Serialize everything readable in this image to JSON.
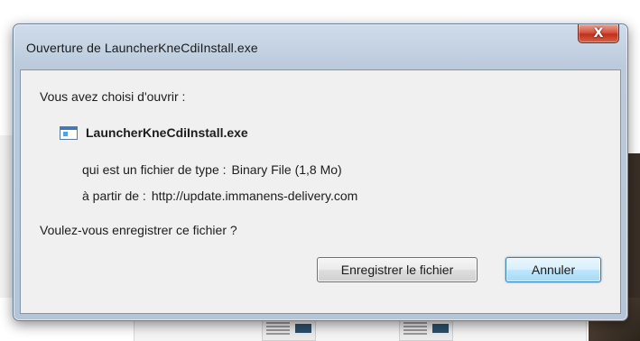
{
  "dialog": {
    "title": "Ouverture de LauncherKneCdiInstall.exe",
    "close_glyph": "X",
    "intro": "Vous avez choisi d'ouvrir :",
    "file": {
      "icon": "exe-file-icon",
      "name": "LauncherKneCdiInstall.exe"
    },
    "type_label": "qui est un fichier de type :",
    "type_value": "Binary File (1,8 Mo)",
    "from_label": "à partir de :",
    "from_value": "http://update.immanens-delivery.com",
    "question": "Voulez-vous enregistrer ce fichier ?",
    "buttons": {
      "save": "Enregistrer le fichier",
      "cancel": "Annuler"
    }
  }
}
